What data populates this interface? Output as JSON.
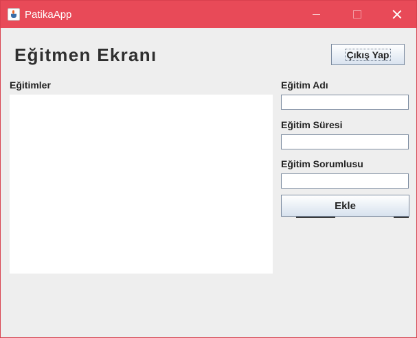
{
  "window": {
    "title": "PatikaApp",
    "icon": "java-cup-icon",
    "controls": [
      "minimize-icon",
      "maximize-icon",
      "close-icon"
    ]
  },
  "header": {
    "title": "Eğitmen Ekranı",
    "logout_label": "Çıkış Yap"
  },
  "left": {
    "list_label": "Eğitimler"
  },
  "form": {
    "name_label": "Eğitim Adı",
    "name_value": "",
    "duration_label": "Eğitim Süresi",
    "duration_value": "",
    "owner_label": "Eğitim Sorumlusu",
    "owner_value": "",
    "add_label": "Ekle"
  },
  "colors": {
    "titlebar": "#e84a58",
    "background": "#eeeeee"
  }
}
